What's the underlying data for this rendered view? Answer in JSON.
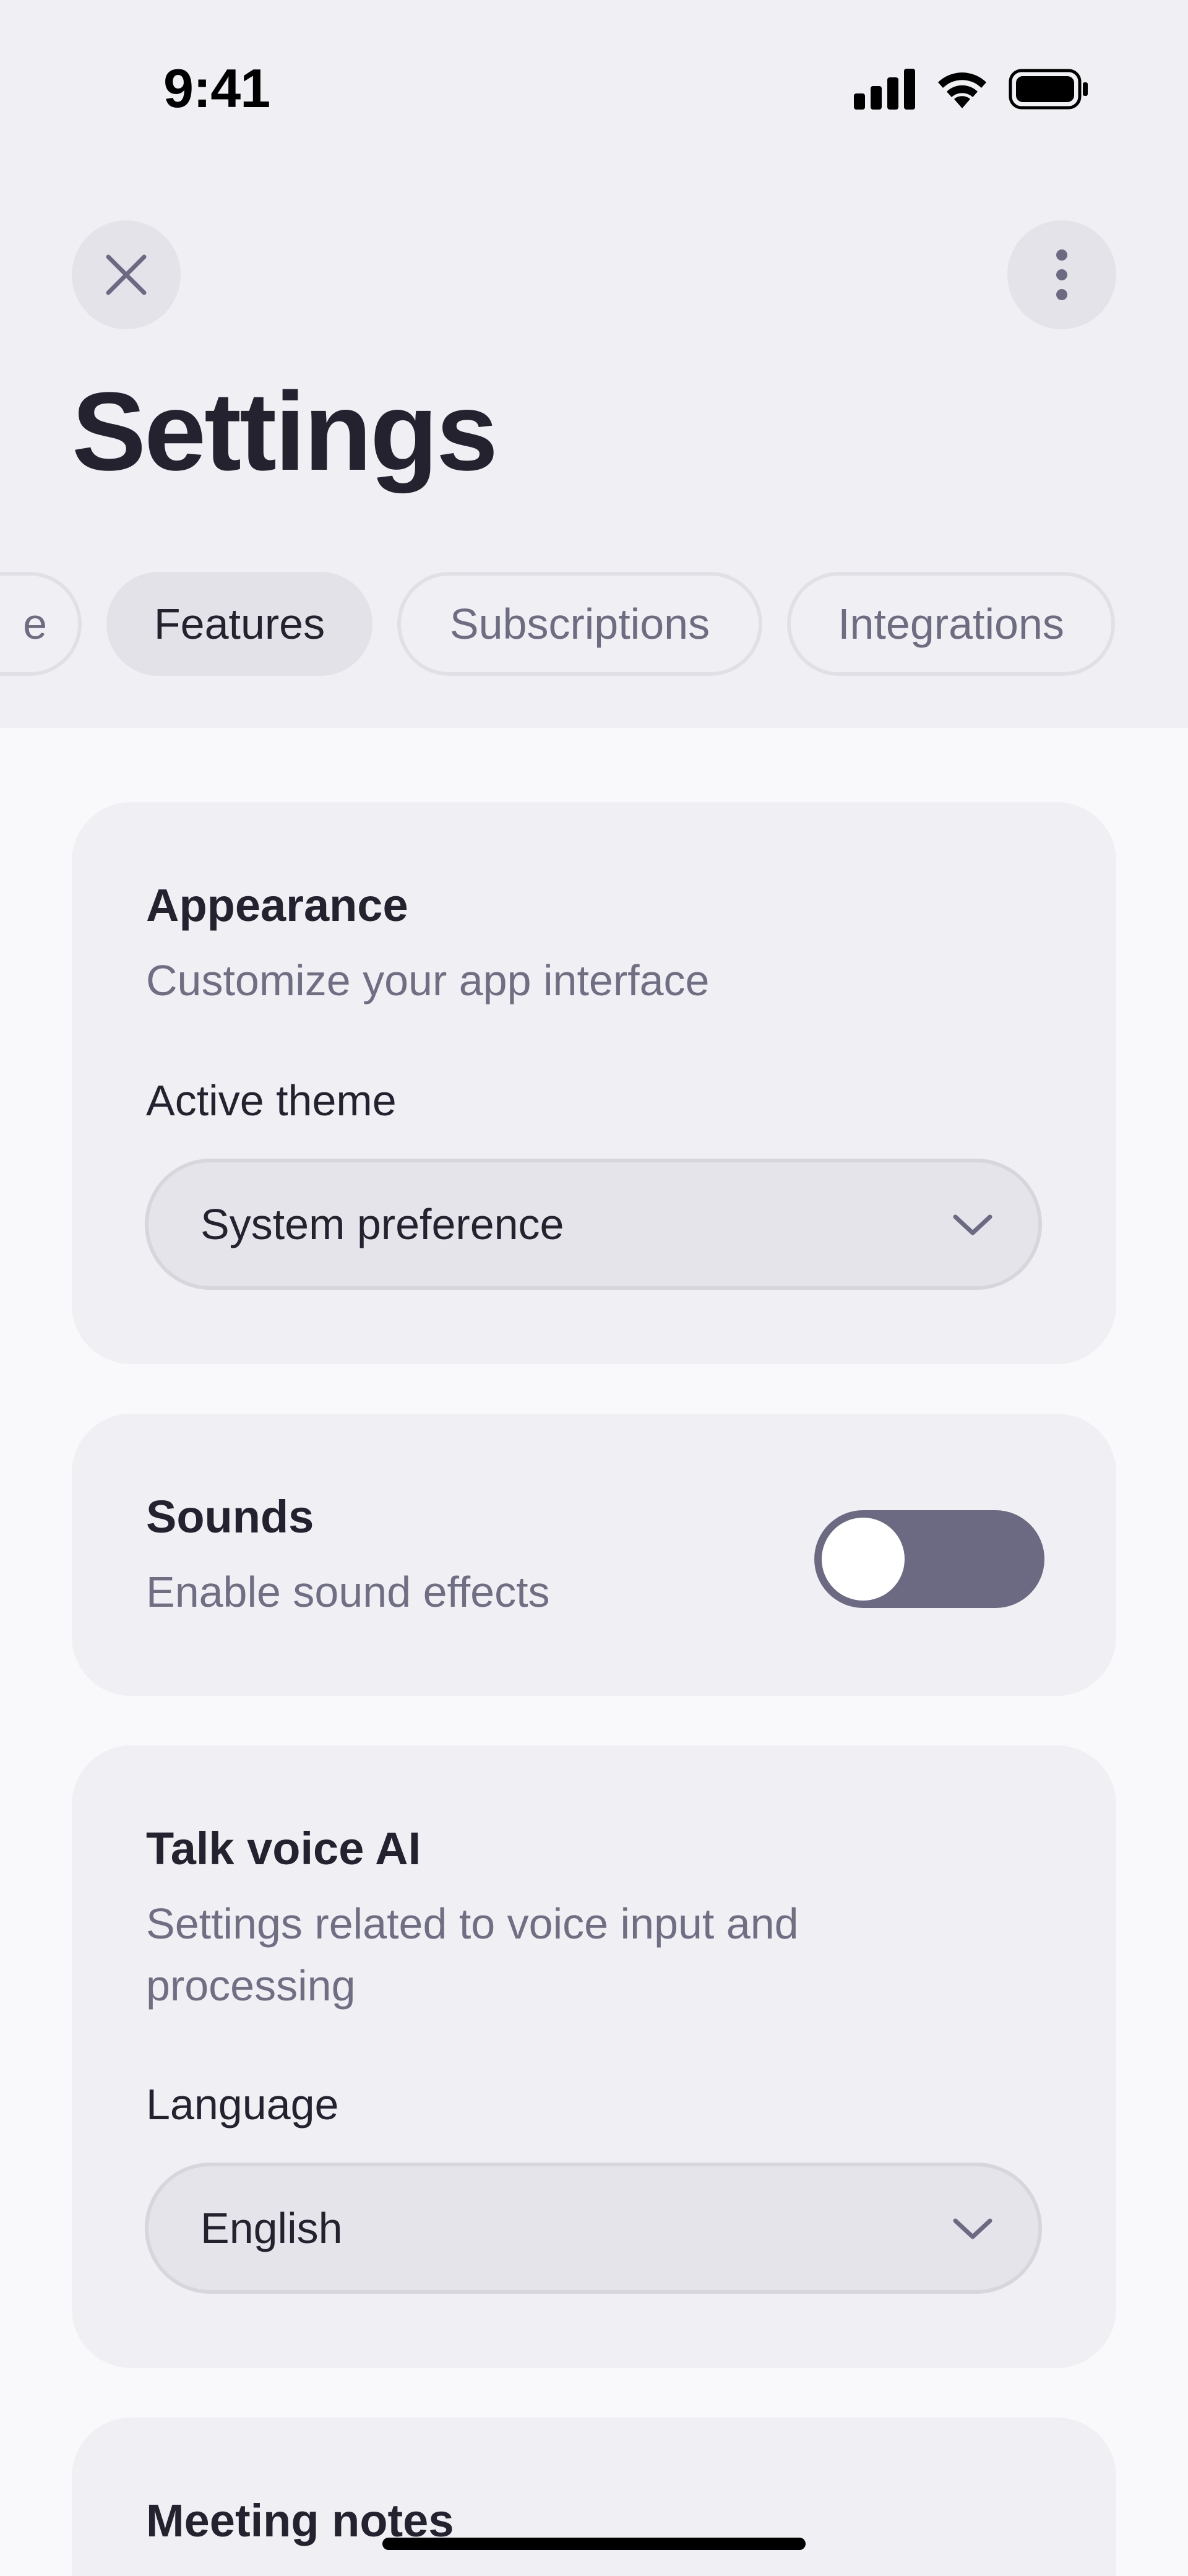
{
  "status_bar": {
    "time": "9:41"
  },
  "header": {
    "close_icon": "close-icon",
    "more_icon": "more-vertical-icon",
    "title": "Settings"
  },
  "tabs": [
    {
      "label": "e",
      "active": false
    },
    {
      "label": "Features",
      "active": true
    },
    {
      "label": "Subscriptions",
      "active": false
    },
    {
      "label": "Integrations",
      "active": false
    }
  ],
  "appearance": {
    "title": "Appearance",
    "subtitle": "Customize your app interface",
    "field_label": "Active theme",
    "value": "System preference"
  },
  "sounds": {
    "title": "Sounds",
    "subtitle": "Enable sound effects",
    "enabled": false
  },
  "voice": {
    "title": "Talk voice AI",
    "subtitle": "Settings related to voice input and processing",
    "field_label": "Language",
    "value": "English"
  },
  "meeting_notes": {
    "title": "Meeting notes"
  },
  "colors": {
    "header_bg": "#efeff4",
    "page_bg": "#f9f9fc",
    "card_bg": "#efeff4",
    "toggle_track": "#6b6a82",
    "text_primary": "#24222f",
    "text_secondary": "#706e83"
  }
}
